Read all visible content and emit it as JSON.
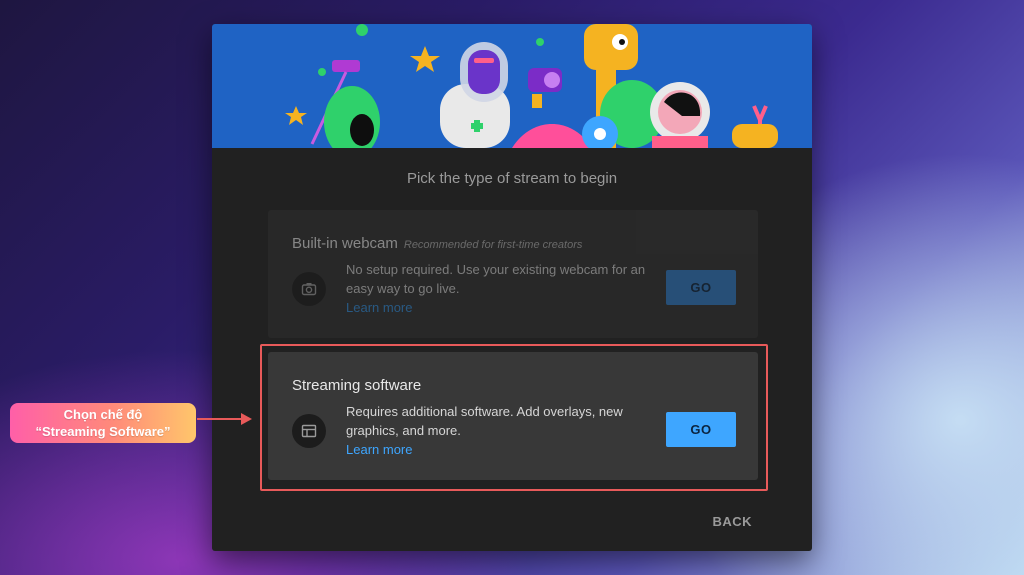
{
  "dialog": {
    "prompt": "Pick the type of stream to begin",
    "back_label": "BACK"
  },
  "cards": {
    "webcam": {
      "title": "Built-in webcam",
      "note": "Recommended for first-time creators",
      "description": "No setup required. Use your existing webcam for an easy way to go live.",
      "learn_more": "Learn more",
      "go_label": "GO",
      "icon": "camera-icon",
      "state": "dimmed"
    },
    "software": {
      "title": "Streaming software",
      "description": "Requires additional software. Add overlays, new graphics, and more.",
      "learn_more": "Learn more",
      "go_label": "GO",
      "icon": "layout-window-icon",
      "state": "highlighted"
    }
  },
  "annotation": {
    "line1": "Chọn chế độ",
    "line2": "“Streaming Software”",
    "highlight_color": "#e85a5a"
  },
  "colors": {
    "accent_blue": "#3ea6ff",
    "dialog_bg": "#212121",
    "banner_bg": "#1f63c4"
  }
}
